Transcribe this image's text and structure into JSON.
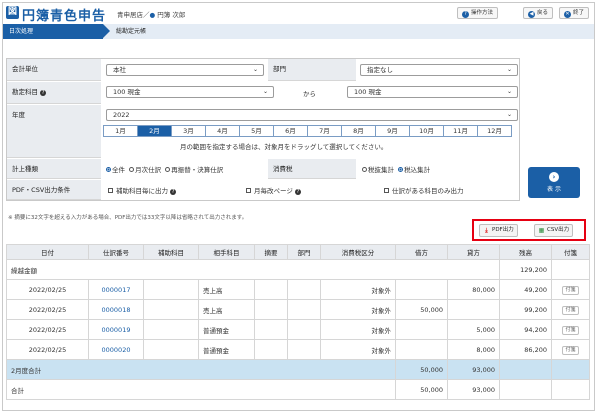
{
  "app": {
    "title": "円簿青色申告",
    "logo_glyph": "図"
  },
  "header": {
    "user": "青申居店／",
    "user_name": "円簿 次郎",
    "help_btn": "操作方法",
    "back_btn": "戻る",
    "close_btn": "終了"
  },
  "nav": {
    "crumb1": "日次処理",
    "crumb2": "総勘定元帳"
  },
  "form": {
    "unit_label": "会計単位",
    "unit_value": "本社",
    "dept_label": "部門",
    "dept_value": "指定なし",
    "account_label": "勘定科目",
    "account_from": "100 現金",
    "from_to": "から",
    "account_to": "100 現金",
    "year_label": "年度",
    "year_value": "2022",
    "months": [
      "1月",
      "2月",
      "3月",
      "4月",
      "5月",
      "6月",
      "7月",
      "8月",
      "9月",
      "10月",
      "11月",
      "12月"
    ],
    "selected_month_index": 1,
    "month_hint": "月の範囲を指定する場合は、対象月をドラッグして選択してください。",
    "calc_label": "計上種類",
    "calc_options": [
      "全件",
      "月次仕訳",
      "再振替・決算仕訳"
    ],
    "tax_label": "消費税",
    "tax_options": [
      "税抜集計",
      "税込集計"
    ],
    "pdf_label": "PDF・CSV出力条件",
    "pdf_opt1": "補助科目毎に出力",
    "pdf_opt2": "月毎改ページ",
    "pdf_opt3": "仕訳がある科目のみ出力",
    "show_btn": "表 示"
  },
  "note": "※ 摘要に32文字を超える入力がある場合、PDF出力では33文字以降は省略されて出力されます。",
  "export": {
    "pdf_btn": "PDF出力",
    "csv_btn": "CSV出力"
  },
  "table": {
    "headers": [
      "日付",
      "仕訳番号",
      "補助科目",
      "相手科目",
      "摘要",
      "部門",
      "消費税区分",
      "借方",
      "貸方",
      "残高",
      "付箋"
    ],
    "carryover_label": "繰越金額",
    "carryover_balance": "129,200",
    "rows": [
      {
        "date": "2022/02/25",
        "no": "0000017",
        "sub": "",
        "counter": "売上高",
        "desc": "",
        "dept": "",
        "tax": "対象外",
        "debit": "",
        "credit": "80,000",
        "balance": "49,200",
        "tag": "付箋"
      },
      {
        "date": "2022/02/25",
        "no": "0000018",
        "sub": "",
        "counter": "売上高",
        "desc": "",
        "dept": "",
        "tax": "対象外",
        "debit": "50,000",
        "credit": "",
        "balance": "99,200",
        "tag": "付箋"
      },
      {
        "date": "2022/02/25",
        "no": "0000019",
        "sub": "",
        "counter": "普通預金",
        "desc": "",
        "dept": "",
        "tax": "対象外",
        "debit": "",
        "credit": "5,000",
        "balance": "94,200",
        "tag": "付箋"
      },
      {
        "date": "2022/02/25",
        "no": "0000020",
        "sub": "",
        "counter": "普通預金",
        "desc": "",
        "dept": "",
        "tax": "対象外",
        "debit": "",
        "credit": "8,000",
        "balance": "86,200",
        "tag": "付箋"
      }
    ],
    "month_total_label": "2月度合計",
    "month_total_debit": "50,000",
    "month_total_credit": "93,000",
    "grand_total_label": "合計",
    "grand_total_debit": "50,000",
    "grand_total_credit": "93,000"
  },
  "colors": {
    "brand": "#1b5fa6",
    "highlight_border": "#e60012",
    "total_row": "#c9e2f2"
  }
}
